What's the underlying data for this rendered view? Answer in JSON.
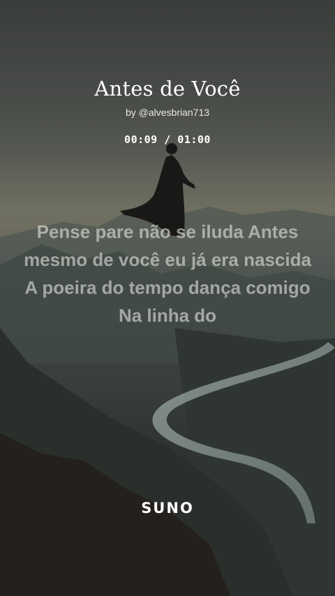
{
  "player": {
    "title": "Antes de Você",
    "byline": "by @alvesbrian713",
    "timer": "00:09 / 01:00",
    "lyrics": "Pense pare não se iluda Antes mesmo de você eu já era nascida A poeira do tempo dança comigo Na linha do"
  },
  "branding": {
    "logo_text": "SUNO"
  },
  "background": {
    "icon": "floating-woman-silhouette-over-mountains-and-river"
  }
}
